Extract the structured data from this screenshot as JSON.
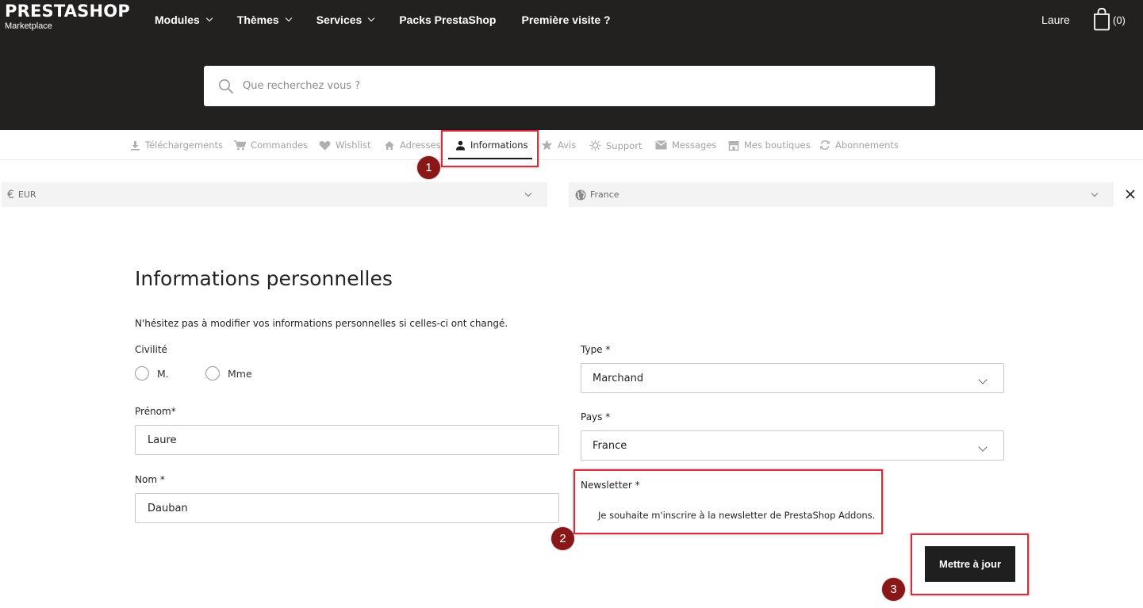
{
  "header": {
    "logo": "PRESTASHOP",
    "logo_sub": "Marketplace",
    "nav": [
      {
        "label": "Modules",
        "dropdown": true
      },
      {
        "label": "Thèmes",
        "dropdown": true
      },
      {
        "label": "Services",
        "dropdown": true
      },
      {
        "label": "Packs PrestaShop",
        "dropdown": false
      },
      {
        "label": "Première visite ?",
        "dropdown": false
      }
    ],
    "user": "Laure",
    "cart_count": "(0)"
  },
  "search": {
    "placeholder": "Que recherchez vous ?"
  },
  "account_tabs": [
    {
      "label": "Téléchargements",
      "icon": "download-icon"
    },
    {
      "label": "Commandes",
      "icon": "cart-icon"
    },
    {
      "label": "Wishlist",
      "icon": "heart-icon"
    },
    {
      "label": "Adresses",
      "icon": "home-icon"
    },
    {
      "label": "Informations",
      "icon": "user-icon",
      "active": true
    },
    {
      "label": "Avis",
      "icon": "star-icon"
    },
    {
      "label": "Support",
      "icon": "sun-icon"
    },
    {
      "label": "Messages",
      "icon": "envelope-icon"
    },
    {
      "label": "Mes boutiques",
      "icon": "store-icon"
    },
    {
      "label": "Abonnements",
      "icon": "refresh-icon"
    }
  ],
  "locale": {
    "currency": "EUR",
    "country": "France"
  },
  "form": {
    "title": "Informations personnelles",
    "intro": "N'hésitez pas à modifier vos informations personnelles si celles-ci ont changé.",
    "civility_label": "Civilité",
    "civility_options": [
      "M.",
      "Mme"
    ],
    "firstname_label": "Prénom*",
    "firstname_value": "Laure",
    "lastname_label": "Nom *",
    "lastname_value": "Dauban",
    "type_label": "Type *",
    "type_value": "Marchand",
    "country_label": "Pays *",
    "country_value": "France",
    "newsletter_label": "Newsletter *",
    "newsletter_text": "Je souhaite m'inscrire à la newsletter de PrestaShop Addons.",
    "submit_label": "Mettre à jour"
  },
  "annotations": {
    "color": "#d92b3a",
    "badge_color": "#8a1717",
    "steps": [
      "1",
      "2",
      "3"
    ]
  }
}
